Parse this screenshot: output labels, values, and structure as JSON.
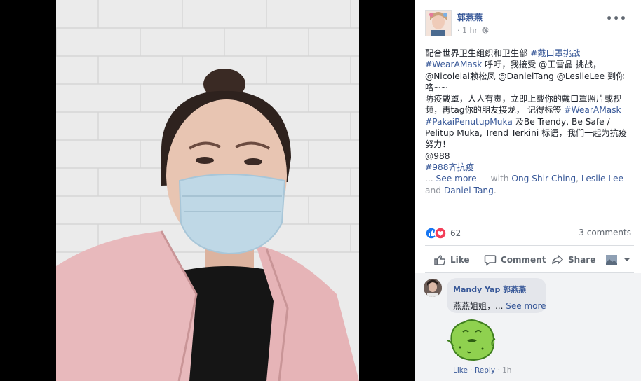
{
  "post": {
    "author": "郭燕燕",
    "time": "1 hr",
    "text": {
      "l1a": "配合世界卫生组织和卫生部 ",
      "l1tag": "#戴口罩挑战",
      "l2tag": "#WearAMask",
      "l2b": " 呼吁，我接受 @王雪晶 挑战，",
      "l3": "@Nicolelai赖松凤 @DanielTang @LeslieLee 到你",
      "l4": "咯~~",
      "l5": "防疫戴罩，人人有责，立即上载你的戴口罩照片或视",
      "l6a": "频，再tag你的朋友接龙， 记得标签 ",
      "l6tag": "#WearAMask",
      "l7tag": "#PakaiPenutupMuka",
      "l7b": " 及Be Trendy, Be Safe /",
      "l8": "Pelitup Muka, Trend Terkini 标语，我们一起为抗疫",
      "l9": "努力！",
      "l10": "@988",
      "l11tag": "#988齐抗疫",
      "l12a": "... ",
      "see_more": "See more",
      "with": " — with ",
      "tagged1": "Ong Shir Ching",
      "comma": ", ",
      "tagged2": "Leslie Lee",
      "and": "and ",
      "tagged3": "Daniel Tang",
      "dot": "."
    },
    "reaction_count": "62",
    "comment_count": "3 comments"
  },
  "actions": {
    "like": "Like",
    "comment": "Comment",
    "share": "Share"
  },
  "comment": {
    "author": "Mandy Yap 郭燕燕",
    "text": "燕燕姐姐，... ",
    "see_more": "See more",
    "like": "Like",
    "dot": " · ",
    "reply": "Reply",
    "time": "1h"
  },
  "colors": {
    "link": "#385898",
    "muted": "#90949c",
    "like_blue": "#1877f2",
    "love_red": "#f33e58"
  }
}
